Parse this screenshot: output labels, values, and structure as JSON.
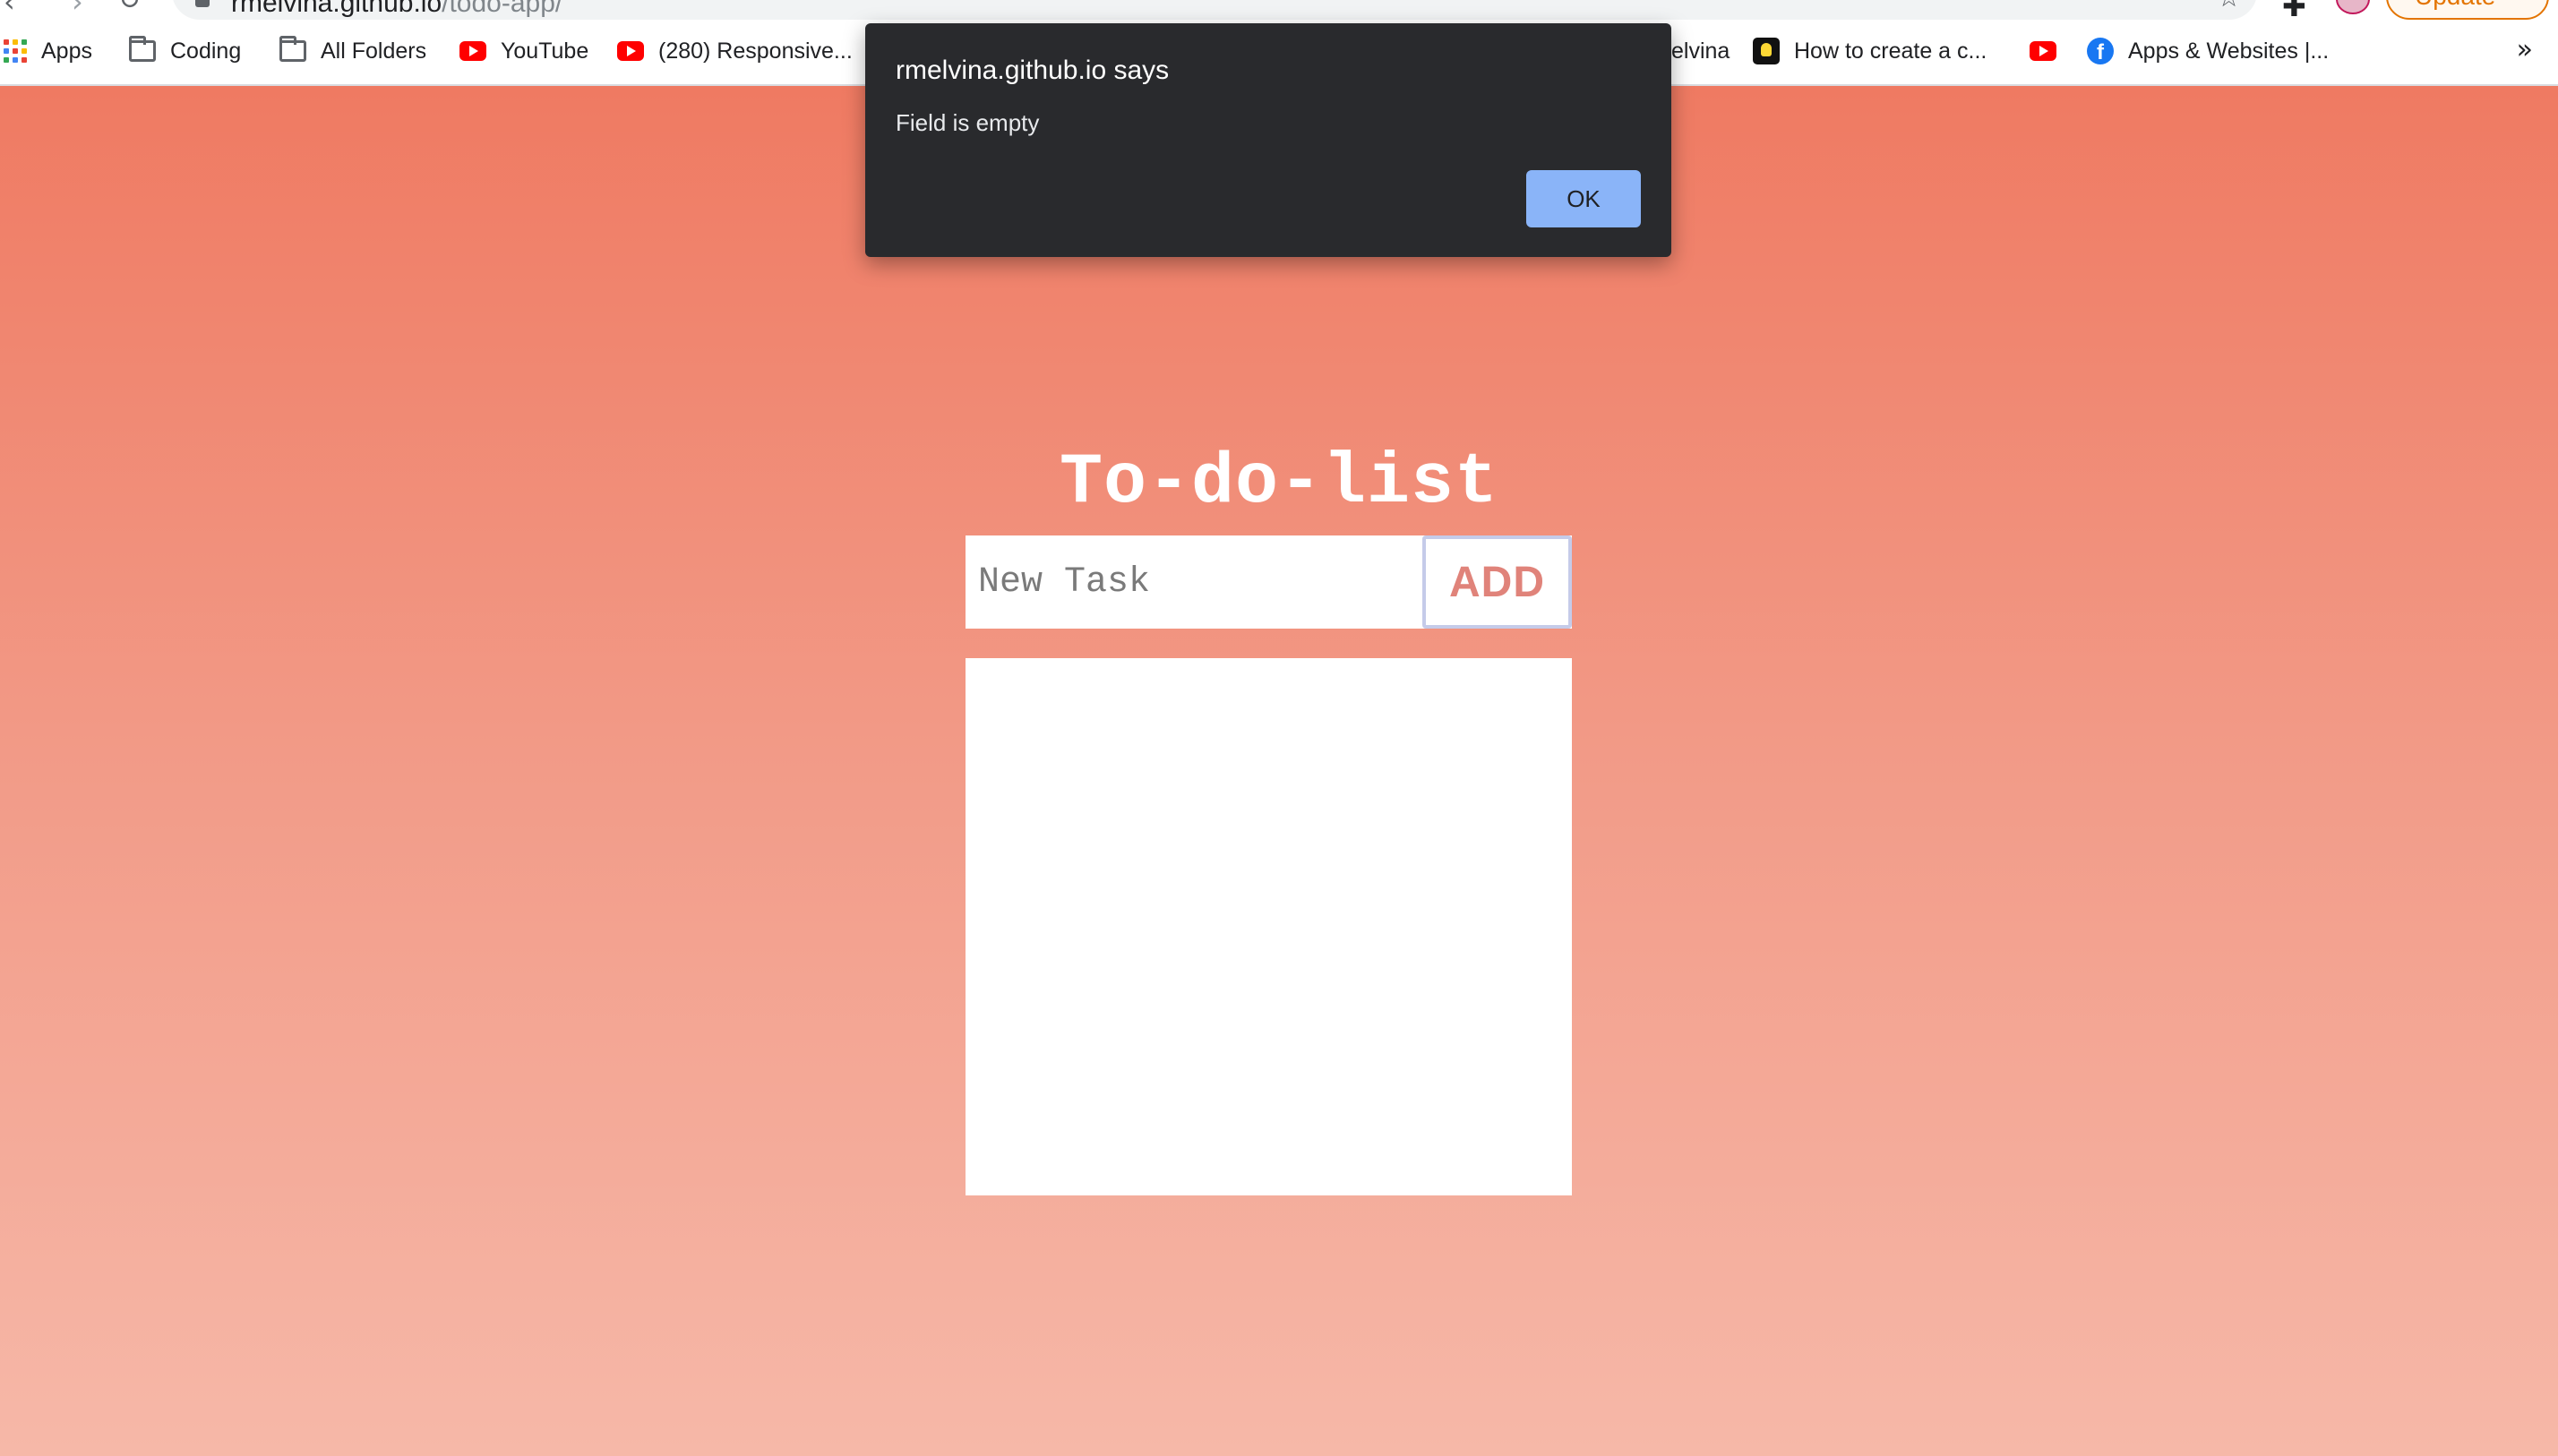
{
  "browser": {
    "url_host": "rmelvina.github.io",
    "url_path": "/todo-app/",
    "update_label": "Update"
  },
  "bookmarks": [
    {
      "label": "Apps",
      "icon": "apps-grid-icon"
    },
    {
      "label": "Coding",
      "icon": "folder-icon"
    },
    {
      "label": "All Folders",
      "icon": "folder-icon"
    },
    {
      "label": "YouTube",
      "icon": "youtube-icon"
    },
    {
      "label": "(280) Responsive...",
      "icon": "youtube-icon"
    },
    {
      "label": "elvina",
      "icon": ""
    },
    {
      "label": "How to create a c...",
      "icon": "lightbulb-icon"
    },
    {
      "label": "",
      "icon": "youtube-icon"
    },
    {
      "label": "Apps & Websites |...",
      "icon": "facebook-icon"
    }
  ],
  "bookmarks_more": "»",
  "app": {
    "title": "To-do-list",
    "input_placeholder": "New Task",
    "add_label": "ADD"
  },
  "alert": {
    "title": "rmelvina.github.io says",
    "message": "Field is empty",
    "ok_label": "OK"
  },
  "colors": {
    "gradient_top": "#ef7a62",
    "gradient_bottom": "#f6b8a8",
    "add_text": "#e0837a",
    "alert_bg": "#292a2d",
    "ok_button": "#8ab4f8"
  }
}
